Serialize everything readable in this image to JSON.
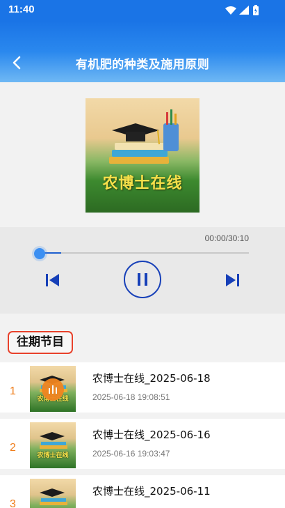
{
  "status_bar": {
    "time": "11:40",
    "icons": [
      "wifi-icon",
      "signal-icon",
      "battery-icon"
    ]
  },
  "header": {
    "back_icon": "chevron-left-icon",
    "title": "有机肥的种类及施用原则"
  },
  "cover": {
    "text": "农博士在线"
  },
  "player": {
    "time_display": "00:00/30:10",
    "progress": 0.0,
    "controls": [
      "previous-icon",
      "pause-icon",
      "next-icon"
    ]
  },
  "list": {
    "section_title": "往期节目",
    "episodes": [
      {
        "number": "1",
        "title": "农博士在线_2025-06-18",
        "date": "2025-06-18 19:08:51",
        "thumb_text": "农博士在线",
        "playing": true
      },
      {
        "number": "2",
        "title": "农博士在线_2025-06-16",
        "date": "2025-06-16 19:03:47",
        "thumb_text": "农博士在线",
        "playing": false
      },
      {
        "number": "3",
        "title": "农博士在线_2025-06-11",
        "date": "",
        "thumb_text": "",
        "playing": false
      }
    ]
  },
  "colors": {
    "header_blue": "#1a74e6",
    "accent_orange": "#ef7d1a",
    "highlight_red": "#e8412b",
    "control_blue": "#1740b8"
  }
}
